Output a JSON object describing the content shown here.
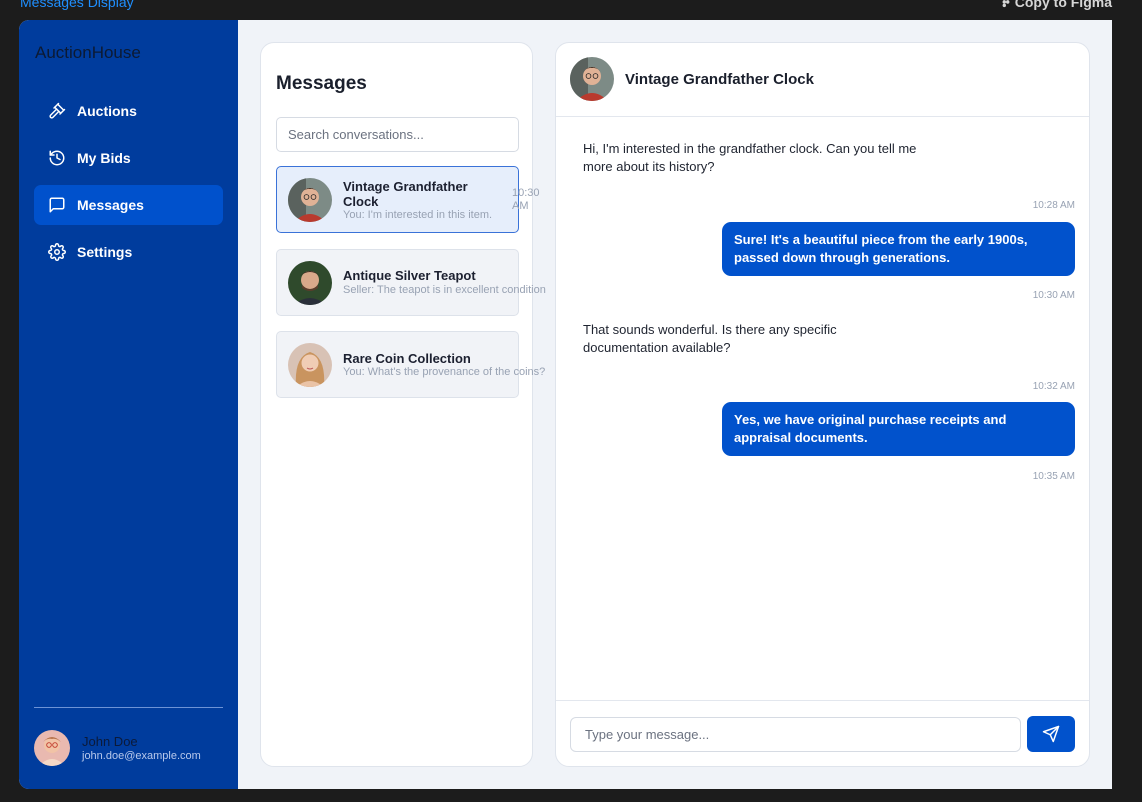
{
  "frame": {
    "title": "Messages Display",
    "copy_label": "Copy to Figma"
  },
  "sidebar": {
    "brand": "AuctionHouse",
    "items": [
      {
        "label": "Auctions",
        "icon": "gavel-icon"
      },
      {
        "label": "My Bids",
        "icon": "history-icon"
      },
      {
        "label": "Messages",
        "icon": "message-icon",
        "active": true
      },
      {
        "label": "Settings",
        "icon": "gear-icon"
      }
    ],
    "user": {
      "name": "John Doe",
      "email": "john.doe@example.com"
    }
  },
  "conversations": {
    "title": "Messages",
    "search_placeholder": "Search conversations...",
    "items": [
      {
        "name": "Vintage Grandfather Clock",
        "preview": "You: I'm interested in this item.",
        "time": "10:30 AM",
        "active": true
      },
      {
        "name": "Antique Silver Teapot",
        "preview": "Seller: The teapot is in excellent condition"
      },
      {
        "name": "Rare Coin Collection",
        "preview": "You: What's the provenance of the coins?"
      }
    ]
  },
  "chat": {
    "title": "Vintage Grandfather Clock",
    "messages": [
      {
        "direction": "in",
        "text": "Hi, I'm interested in the grandfather clock. Can you tell me more about its history?",
        "time": "10:28 AM"
      },
      {
        "direction": "out",
        "text": "Sure! It's a beautiful piece from the early 1900s, passed down through generations.",
        "time": "10:30 AM"
      },
      {
        "direction": "in",
        "text": "That sounds wonderful. Is there any specific documentation available?",
        "time": "10:32 AM"
      },
      {
        "direction": "out",
        "text": "Yes, we have original purchase receipts and appraisal documents.",
        "time": "10:35 AM"
      }
    ],
    "input_placeholder": "Type your message...",
    "send_icon": "send-icon"
  },
  "colors": {
    "sidebar": "#003c9d",
    "active_nav": "#0051cc",
    "accent": "#0152cc",
    "frame_title": "#1f8fff"
  }
}
